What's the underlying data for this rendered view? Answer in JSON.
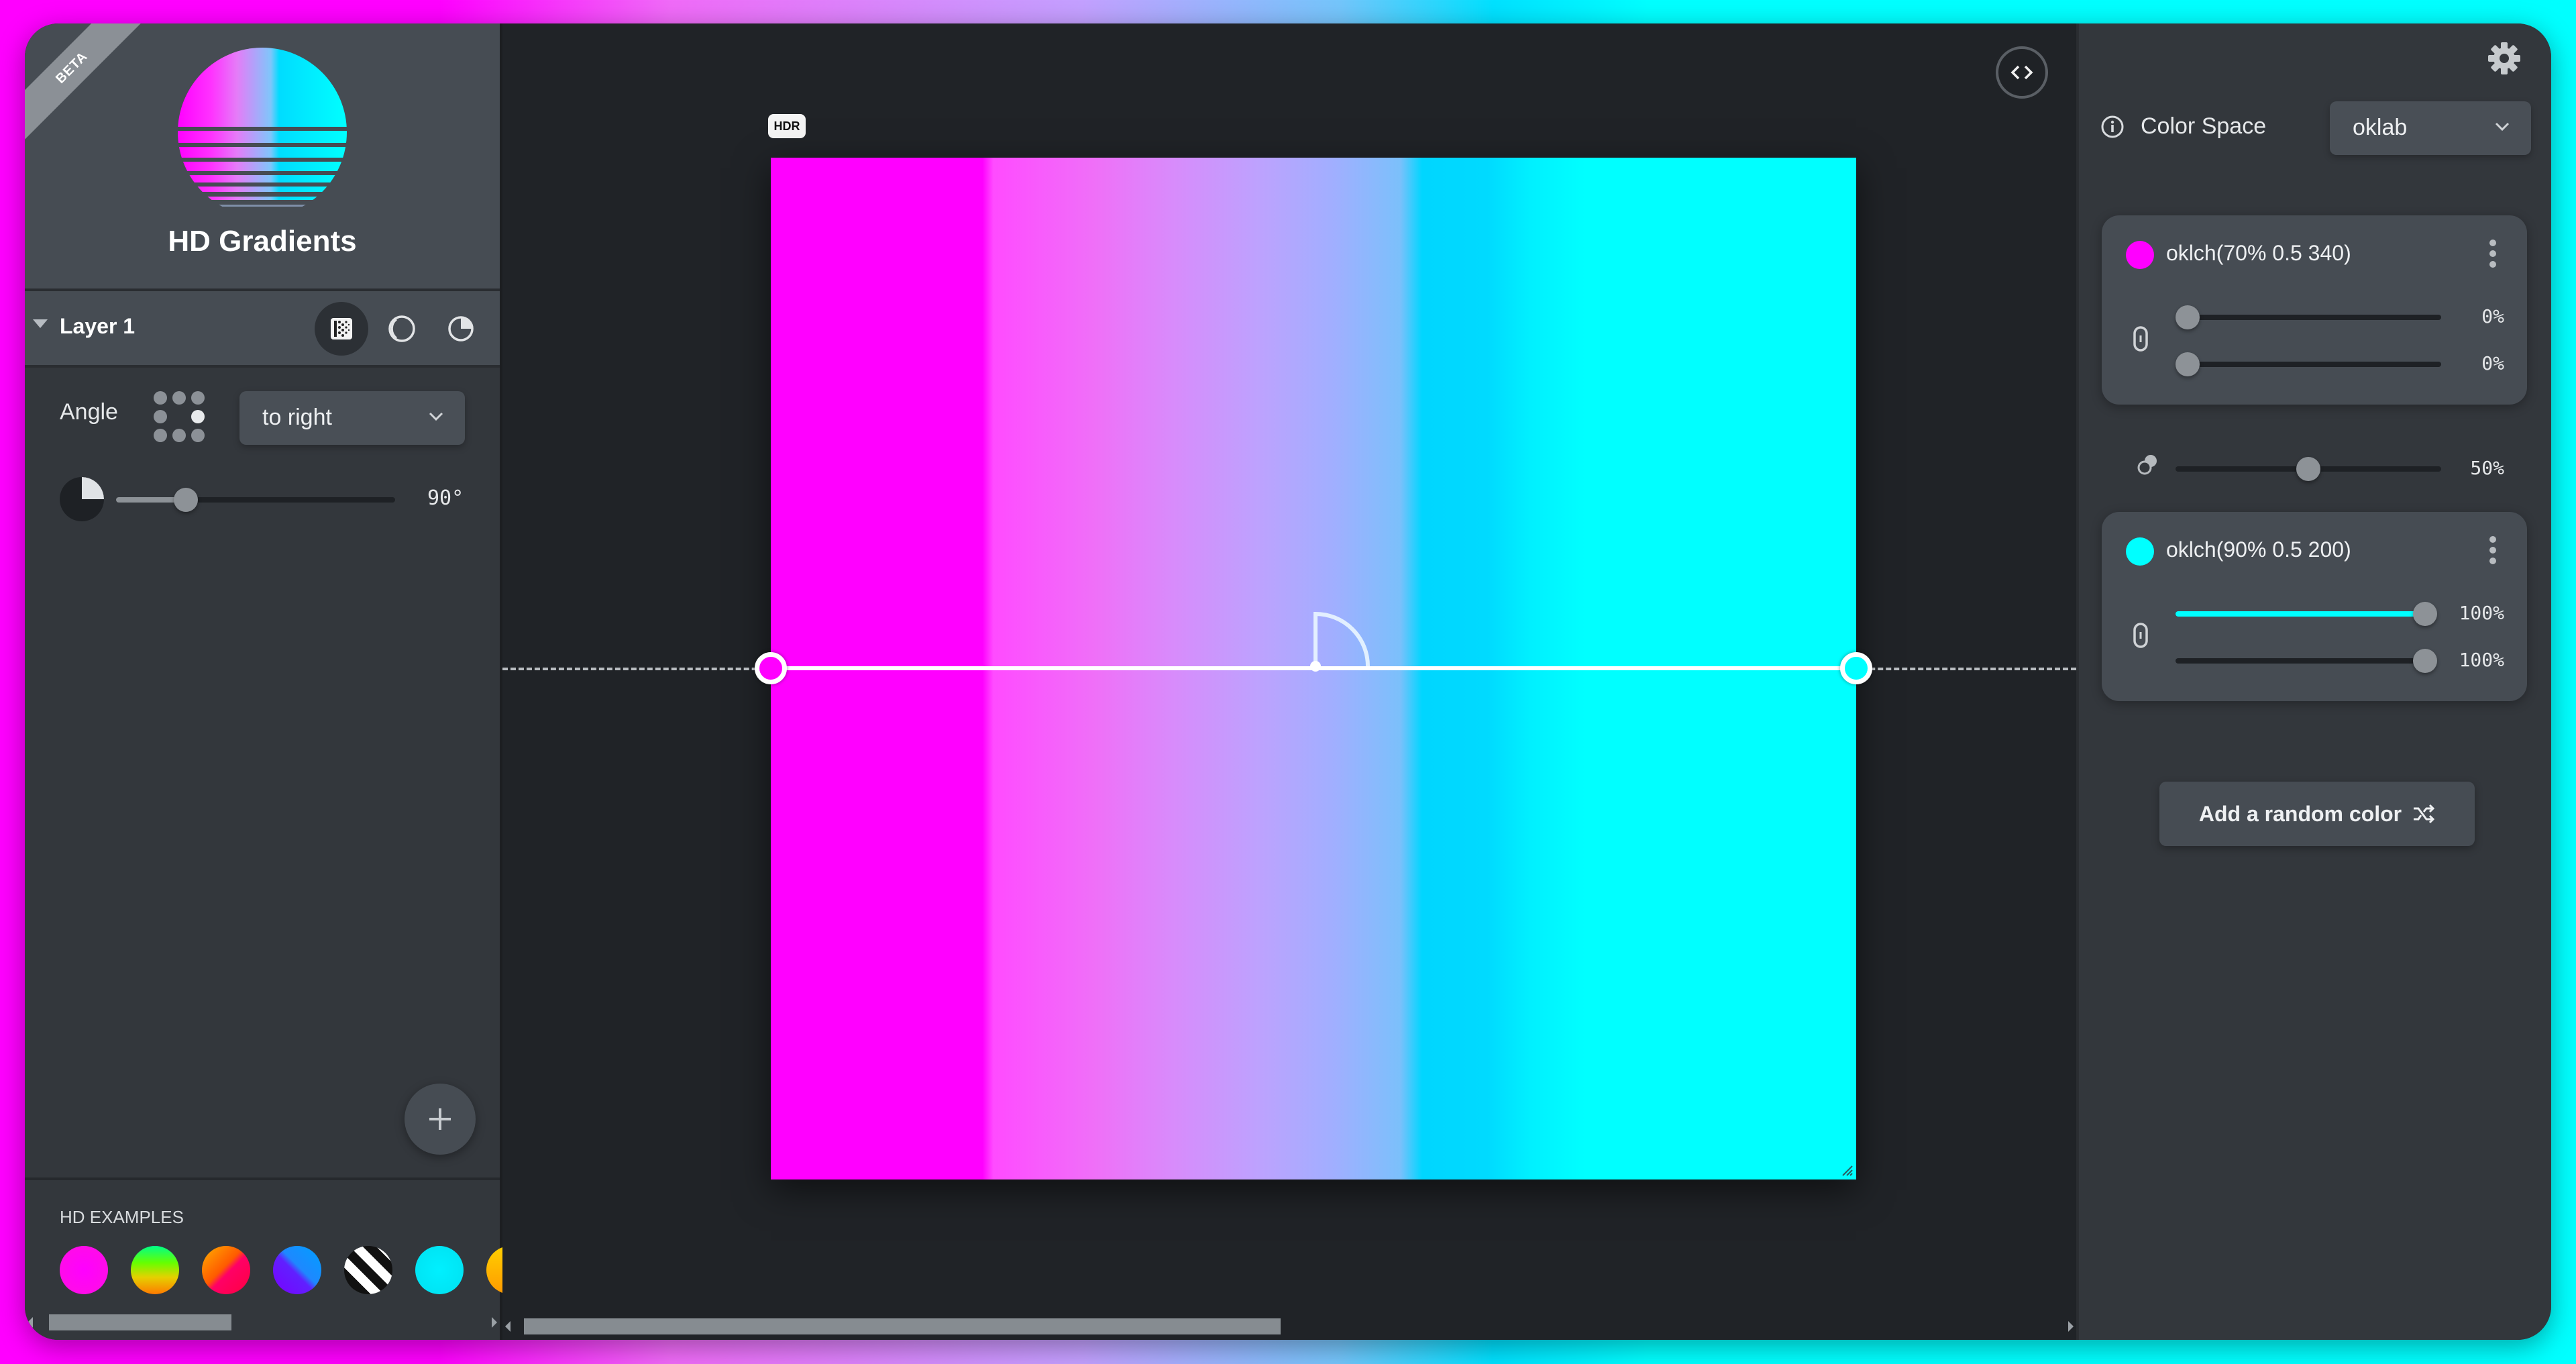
{
  "app": {
    "title": "HD Gradients",
    "badge": "BETA"
  },
  "layer": {
    "name": "Layer 1",
    "types": [
      {
        "name": "linear",
        "icon": "linear-gradient-icon",
        "active": true
      },
      {
        "name": "radial",
        "icon": "radial-gradient-icon",
        "active": false
      },
      {
        "name": "conic",
        "icon": "conic-gradient-icon",
        "active": false
      }
    ],
    "angle_label": "Angle",
    "direction_selected": "to right",
    "angle_value": "90°",
    "angle_fraction": 0.25
  },
  "examples": {
    "title": "HD EXAMPLES",
    "swatches": [
      {
        "name": "magenta",
        "css": "radial-gradient(circle at 50% 50%, #ff00ff, #ff10e0)"
      },
      {
        "name": "rainbow",
        "css": "linear-gradient(to bottom, #00ff88 0%, #66ff00 35%, #e5d000 65%, #ff7a00 100%)"
      },
      {
        "name": "sunset",
        "css": "linear-gradient(135deg, #ffb000 0%, #ff5a00 45%, #ff0066 55%, #ff0040 100%)"
      },
      {
        "name": "violet-blue",
        "css": "linear-gradient(45deg, #7a00ff 0%, #6020ff 45%, #1e88ff 55%, #00a0ff 100%)"
      },
      {
        "name": "stripes",
        "css": "repeating-linear-gradient(45deg, #ffffff 0 14px, #111111 14px 28px)"
      },
      {
        "name": "cyan",
        "css": "radial-gradient(circle, #00f0ff, #00e0f0)"
      },
      {
        "name": "gold",
        "css": "linear-gradient(to bottom, #ffd000, #ff9a00)"
      }
    ]
  },
  "canvas": {
    "hdr_badge": "HDR",
    "code_toggle_icon": "code-icon"
  },
  "color_space": {
    "label": "Color Space",
    "selected": "oklab"
  },
  "stops": [
    {
      "label": "oklch(70% 0.5 340)",
      "color": "#ff00ff",
      "position": {
        "value": "0%",
        "fraction": 0.0
      },
      "hint": {
        "value": "0%",
        "fraction": 0.0
      }
    },
    {
      "label": "oklch(90% 0.5 200)",
      "color": "#00ffff",
      "position": {
        "value": "100%",
        "fraction": 1.0
      },
      "hint": {
        "value": "100%",
        "fraction": 1.0
      }
    }
  ],
  "midpoint": {
    "value": "50%",
    "fraction": 0.5
  },
  "actions": {
    "add_random_color": "Add a random color"
  },
  "colors": {
    "accent_cyan": "#00ffff",
    "accent_magenta": "#ff00ff"
  }
}
